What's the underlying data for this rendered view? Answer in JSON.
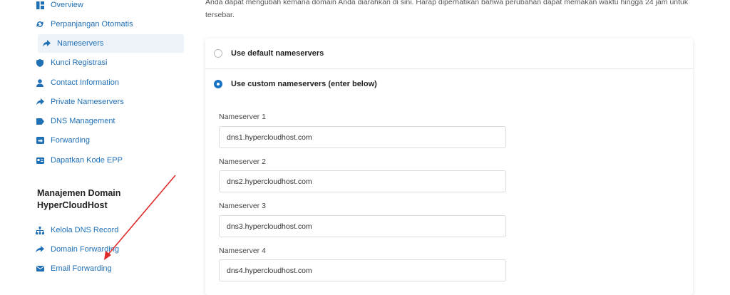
{
  "sidebar": {
    "items": [
      {
        "label": "Overview",
        "icon": "dashboard-icon"
      },
      {
        "label": "Perpanjangan Otomatis",
        "icon": "sync-icon"
      },
      {
        "label": "Nameservers",
        "icon": "share-arrow-icon",
        "active": true
      },
      {
        "label": "Kunci Registrasi",
        "icon": "shield-icon"
      },
      {
        "label": "Contact Information",
        "icon": "user-icon"
      },
      {
        "label": "Private Nameservers",
        "icon": "share-arrow-icon"
      },
      {
        "label": "DNS Management",
        "icon": "tag-icon"
      },
      {
        "label": "Forwarding",
        "icon": "forward-box-icon"
      },
      {
        "label": "Dapatkan Kode EPP",
        "icon": "id-card-icon"
      }
    ],
    "section_title": "Manajemen Domain HyperCloudHost",
    "section_items": [
      {
        "label": "Kelola DNS Record",
        "icon": "sitemap-icon"
      },
      {
        "label": "Domain Forwarding",
        "icon": "reply-arrow-icon"
      },
      {
        "label": "Email Forwarding",
        "icon": "envelope-icon"
      }
    ]
  },
  "main": {
    "intro": "Anda dapat mengubah kemana domain Anda diarahkan di sini. Harap diperhatikan bahwa perubahan dapat memakan waktu hingga 24 jam untuk tersebar.",
    "option_default": "Use default nameservers",
    "option_custom": "Use custom nameservers (enter below)",
    "nameservers": [
      {
        "label": "Nameserver 1",
        "value": "dns1.hypercloudhost.com"
      },
      {
        "label": "Nameserver 2",
        "value": "dns2.hypercloudhost.com"
      },
      {
        "label": "Nameserver 3",
        "value": "dns3.hypercloudhost.com"
      },
      {
        "label": "Nameserver 4",
        "value": "dns4.hypercloudhost.com"
      }
    ]
  },
  "colors": {
    "link": "#1f6fb5",
    "radio_checked": "#1a72c4",
    "annotation_arrow": "#e02b2b"
  }
}
